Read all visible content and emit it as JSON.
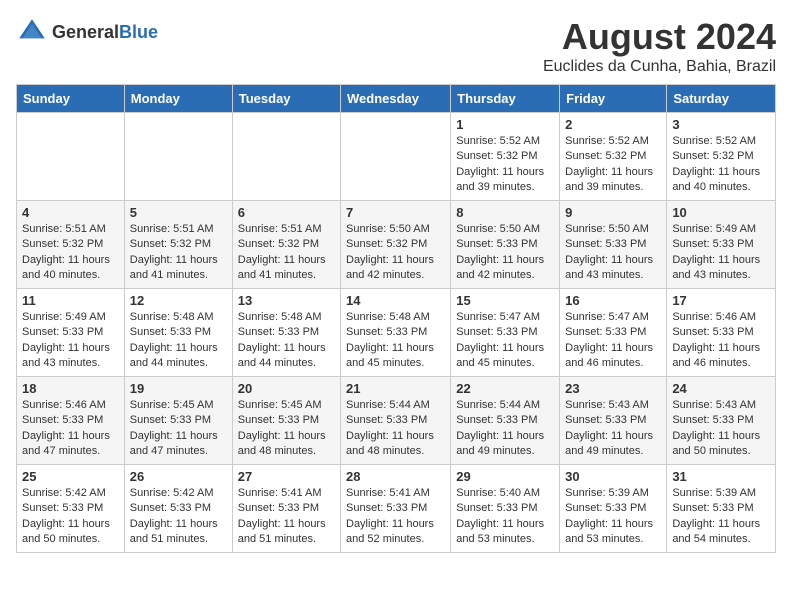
{
  "header": {
    "logo_general": "General",
    "logo_blue": "Blue",
    "month_year": "August 2024",
    "location": "Euclides da Cunha, Bahia, Brazil"
  },
  "days_of_week": [
    "Sunday",
    "Monday",
    "Tuesday",
    "Wednesday",
    "Thursday",
    "Friday",
    "Saturday"
  ],
  "weeks": [
    [
      {
        "day": "",
        "sunrise": "",
        "sunset": "",
        "daylight": ""
      },
      {
        "day": "",
        "sunrise": "",
        "sunset": "",
        "daylight": ""
      },
      {
        "day": "",
        "sunrise": "",
        "sunset": "",
        "daylight": ""
      },
      {
        "day": "",
        "sunrise": "",
        "sunset": "",
        "daylight": ""
      },
      {
        "day": "1",
        "sunrise": "Sunrise: 5:52 AM",
        "sunset": "Sunset: 5:32 PM",
        "daylight": "Daylight: 11 hours and 39 minutes."
      },
      {
        "day": "2",
        "sunrise": "Sunrise: 5:52 AM",
        "sunset": "Sunset: 5:32 PM",
        "daylight": "Daylight: 11 hours and 39 minutes."
      },
      {
        "day": "3",
        "sunrise": "Sunrise: 5:52 AM",
        "sunset": "Sunset: 5:32 PM",
        "daylight": "Daylight: 11 hours and 40 minutes."
      }
    ],
    [
      {
        "day": "4",
        "sunrise": "Sunrise: 5:51 AM",
        "sunset": "Sunset: 5:32 PM",
        "daylight": "Daylight: 11 hours and 40 minutes."
      },
      {
        "day": "5",
        "sunrise": "Sunrise: 5:51 AM",
        "sunset": "Sunset: 5:32 PM",
        "daylight": "Daylight: 11 hours and 41 minutes."
      },
      {
        "day": "6",
        "sunrise": "Sunrise: 5:51 AM",
        "sunset": "Sunset: 5:32 PM",
        "daylight": "Daylight: 11 hours and 41 minutes."
      },
      {
        "day": "7",
        "sunrise": "Sunrise: 5:50 AM",
        "sunset": "Sunset: 5:32 PM",
        "daylight": "Daylight: 11 hours and 42 minutes."
      },
      {
        "day": "8",
        "sunrise": "Sunrise: 5:50 AM",
        "sunset": "Sunset: 5:33 PM",
        "daylight": "Daylight: 11 hours and 42 minutes."
      },
      {
        "day": "9",
        "sunrise": "Sunrise: 5:50 AM",
        "sunset": "Sunset: 5:33 PM",
        "daylight": "Daylight: 11 hours and 43 minutes."
      },
      {
        "day": "10",
        "sunrise": "Sunrise: 5:49 AM",
        "sunset": "Sunset: 5:33 PM",
        "daylight": "Daylight: 11 hours and 43 minutes."
      }
    ],
    [
      {
        "day": "11",
        "sunrise": "Sunrise: 5:49 AM",
        "sunset": "Sunset: 5:33 PM",
        "daylight": "Daylight: 11 hours and 43 minutes."
      },
      {
        "day": "12",
        "sunrise": "Sunrise: 5:48 AM",
        "sunset": "Sunset: 5:33 PM",
        "daylight": "Daylight: 11 hours and 44 minutes."
      },
      {
        "day": "13",
        "sunrise": "Sunrise: 5:48 AM",
        "sunset": "Sunset: 5:33 PM",
        "daylight": "Daylight: 11 hours and 44 minutes."
      },
      {
        "day": "14",
        "sunrise": "Sunrise: 5:48 AM",
        "sunset": "Sunset: 5:33 PM",
        "daylight": "Daylight: 11 hours and 45 minutes."
      },
      {
        "day": "15",
        "sunrise": "Sunrise: 5:47 AM",
        "sunset": "Sunset: 5:33 PM",
        "daylight": "Daylight: 11 hours and 45 minutes."
      },
      {
        "day": "16",
        "sunrise": "Sunrise: 5:47 AM",
        "sunset": "Sunset: 5:33 PM",
        "daylight": "Daylight: 11 hours and 46 minutes."
      },
      {
        "day": "17",
        "sunrise": "Sunrise: 5:46 AM",
        "sunset": "Sunset: 5:33 PM",
        "daylight": "Daylight: 11 hours and 46 minutes."
      }
    ],
    [
      {
        "day": "18",
        "sunrise": "Sunrise: 5:46 AM",
        "sunset": "Sunset: 5:33 PM",
        "daylight": "Daylight: 11 hours and 47 minutes."
      },
      {
        "day": "19",
        "sunrise": "Sunrise: 5:45 AM",
        "sunset": "Sunset: 5:33 PM",
        "daylight": "Daylight: 11 hours and 47 minutes."
      },
      {
        "day": "20",
        "sunrise": "Sunrise: 5:45 AM",
        "sunset": "Sunset: 5:33 PM",
        "daylight": "Daylight: 11 hours and 48 minutes."
      },
      {
        "day": "21",
        "sunrise": "Sunrise: 5:44 AM",
        "sunset": "Sunset: 5:33 PM",
        "daylight": "Daylight: 11 hours and 48 minutes."
      },
      {
        "day": "22",
        "sunrise": "Sunrise: 5:44 AM",
        "sunset": "Sunset: 5:33 PM",
        "daylight": "Daylight: 11 hours and 49 minutes."
      },
      {
        "day": "23",
        "sunrise": "Sunrise: 5:43 AM",
        "sunset": "Sunset: 5:33 PM",
        "daylight": "Daylight: 11 hours and 49 minutes."
      },
      {
        "day": "24",
        "sunrise": "Sunrise: 5:43 AM",
        "sunset": "Sunset: 5:33 PM",
        "daylight": "Daylight: 11 hours and 50 minutes."
      }
    ],
    [
      {
        "day": "25",
        "sunrise": "Sunrise: 5:42 AM",
        "sunset": "Sunset: 5:33 PM",
        "daylight": "Daylight: 11 hours and 50 minutes."
      },
      {
        "day": "26",
        "sunrise": "Sunrise: 5:42 AM",
        "sunset": "Sunset: 5:33 PM",
        "daylight": "Daylight: 11 hours and 51 minutes."
      },
      {
        "day": "27",
        "sunrise": "Sunrise: 5:41 AM",
        "sunset": "Sunset: 5:33 PM",
        "daylight": "Daylight: 11 hours and 51 minutes."
      },
      {
        "day": "28",
        "sunrise": "Sunrise: 5:41 AM",
        "sunset": "Sunset: 5:33 PM",
        "daylight": "Daylight: 11 hours and 52 minutes."
      },
      {
        "day": "29",
        "sunrise": "Sunrise: 5:40 AM",
        "sunset": "Sunset: 5:33 PM",
        "daylight": "Daylight: 11 hours and 53 minutes."
      },
      {
        "day": "30",
        "sunrise": "Sunrise: 5:39 AM",
        "sunset": "Sunset: 5:33 PM",
        "daylight": "Daylight: 11 hours and 53 minutes."
      },
      {
        "day": "31",
        "sunrise": "Sunrise: 5:39 AM",
        "sunset": "Sunset: 5:33 PM",
        "daylight": "Daylight: 11 hours and 54 minutes."
      }
    ]
  ]
}
